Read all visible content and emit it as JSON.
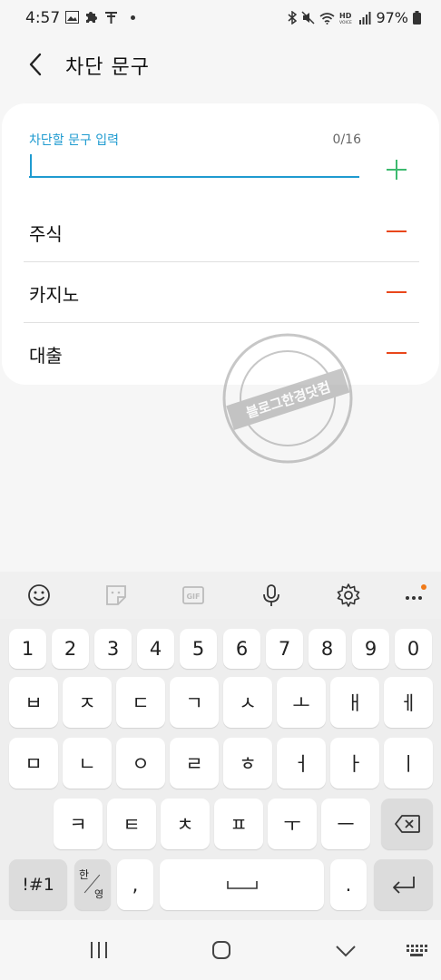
{
  "status_bar": {
    "time": "4:57",
    "battery": "97%",
    "icons": [
      "gallery-icon",
      "puzzle-icon",
      "t-icon",
      "dot",
      "bluetooth-icon",
      "mute-icon",
      "wifi-icon",
      "hd-voice-icon",
      "signal-icon",
      "battery-icon"
    ]
  },
  "header": {
    "title": "차단 문구"
  },
  "input": {
    "label": "차단할 문구 입력",
    "counter": "0/16",
    "value": ""
  },
  "blocked_phrases": [
    "주식",
    "카지노",
    "대출"
  ],
  "watermark": {
    "text": "블로그한경닷컴"
  },
  "keyboard": {
    "toolbar": [
      "emoji-icon",
      "sticker-icon",
      "gif-icon",
      "mic-icon",
      "settings-icon",
      "more-icon"
    ],
    "row_numbers": [
      "1",
      "2",
      "3",
      "4",
      "5",
      "6",
      "7",
      "8",
      "9",
      "0"
    ],
    "row1": [
      "ㅂ",
      "ㅈ",
      "ㄷ",
      "ㄱ",
      "ㅅ",
      "ㅗ",
      "ㅐ",
      "ㅔ"
    ],
    "row2": [
      "ㅁ",
      "ㄴ",
      "ㅇ",
      "ㄹ",
      "ㅎ",
      "ㅓ",
      "ㅏ",
      "ㅣ"
    ],
    "row3": [
      "ㅋ",
      "ㅌ",
      "ㅊ",
      "ㅍ",
      "ㅜ",
      "ㅡ"
    ],
    "symbols_key": "!#1",
    "lang_key_top": "한",
    "lang_key_bottom": "영",
    "comma_key": ",",
    "period_key": "."
  },
  "colors": {
    "accent": "#1f9bd0",
    "add": "#3dba6f",
    "remove": "#e9471b"
  }
}
